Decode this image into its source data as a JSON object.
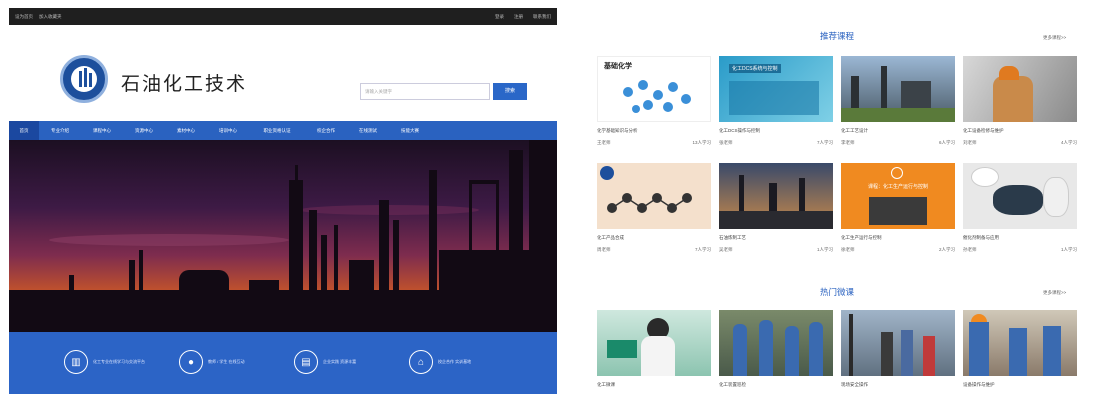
{
  "topbar": {
    "home": "设为首页",
    "fav": "加入收藏夹",
    "login": "登录",
    "reg": "注册",
    "contact": "联系我们"
  },
  "site": {
    "title": "石油化工技术"
  },
  "search": {
    "placeholder": "请输入关键字",
    "button": "搜索"
  },
  "nav": [
    "首页",
    "专业介绍",
    "课程中心",
    "资源中心",
    "素材中心",
    "培训中心",
    "职业资格认证",
    "校企合作",
    "在线测试",
    "技能大赛"
  ],
  "features": [
    {
      "icon": "school-icon",
      "text": "化工专业在线学习与交流平台"
    },
    {
      "icon": "user-icon",
      "text": "教师 / 学生 在线互动"
    },
    {
      "icon": "building-icon",
      "text": "企业实践 资源丰富"
    },
    {
      "icon": "home-icon",
      "text": "校企合作 实训基地"
    }
  ],
  "recommended": {
    "title": "推荐课程",
    "more": "更多课程>>",
    "courses": [
      {
        "name": "化学基础知识与分析",
        "teacher": "王老师",
        "count": "13人学习",
        "label": "基础化学"
      },
      {
        "name": "化工DCS操作与控制",
        "teacher": "张老师",
        "count": "7人学习",
        "label": "化工DCS系统与控制"
      },
      {
        "name": "化工工艺设计",
        "teacher": "李老师",
        "count": "6人学习",
        "label": ""
      },
      {
        "name": "化工设备检修与维护",
        "teacher": "刘老师",
        "count": "4人学习",
        "label": ""
      },
      {
        "name": "化工产品合成",
        "teacher": "周老师",
        "count": "7人学习",
        "label": ""
      },
      {
        "name": "石油炼制工艺",
        "teacher": "吴老师",
        "count": "1人学习",
        "label": ""
      },
      {
        "name": "化工生产运行与控制",
        "teacher": "徐老师",
        "count": "2人学习",
        "label": "课程：化工生产运行与控制"
      },
      {
        "name": "催化剂制备与应用",
        "teacher": "孙老师",
        "count": "1人学习",
        "label": ""
      }
    ]
  },
  "hot": {
    "title": "热门微课",
    "more": "更多课程>>",
    "courses": [
      {
        "name": "化工微课"
      },
      {
        "name": "化工装置巡检"
      },
      {
        "name": "现场安全操作"
      },
      {
        "name": "设备操作与维护"
      }
    ]
  }
}
